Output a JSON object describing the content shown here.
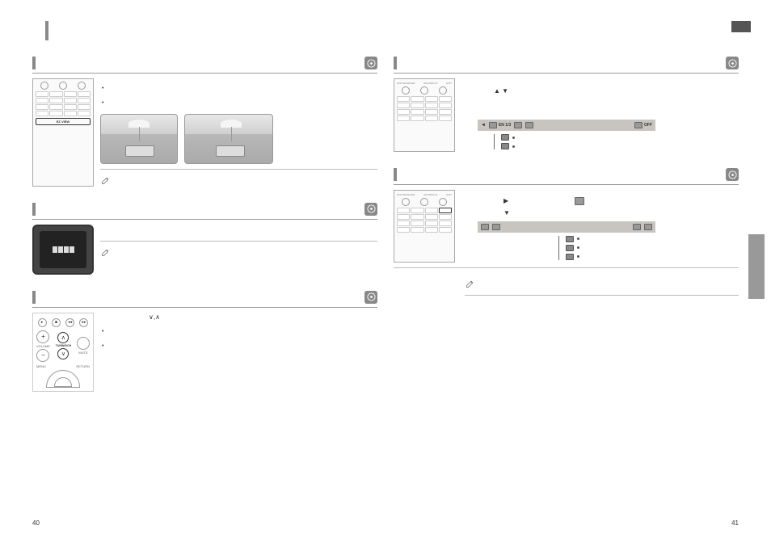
{
  "pageNumbers": {
    "left": "40",
    "right": "41"
  },
  "left": {
    "sections": [
      {
        "id": "ezview",
        "remoteHighlight": "EZ VIEW",
        "bullets": [
          "",
          ""
        ]
      },
      {
        "id": "tv-screen",
        "body": ""
      },
      {
        "id": "tuning",
        "tuningLabel": "TUNING/CH",
        "tuningUp": "∧",
        "tuningDown": "∨",
        "bullets": [
          "",
          ""
        ],
        "arrowSymbols": "∨,∧"
      }
    ]
  },
  "right": {
    "sections": [
      {
        "id": "audio-lang",
        "infoBar": {
          "leftArrow": "◄",
          "segments": [
            {
              "icon": true,
              "label": "EN 1/3"
            },
            {
              "icon": true,
              "label": ""
            },
            {
              "icon": true,
              "label": ""
            },
            {
              "label": "OFF"
            }
          ]
        },
        "arrowsText": "▲ ▼",
        "subItems": 2
      },
      {
        "id": "subtitle-lang",
        "infoBar": {
          "segments": [
            {
              "icon": true,
              "label": ""
            },
            {
              "icon": true,
              "label": ""
            },
            {
              "icon": true,
              "label": ""
            },
            {
              "icon": true,
              "label": ""
            }
          ]
        },
        "playArrow": "▶",
        "downArrow": "▼",
        "subItems": 3
      }
    ]
  },
  "remoteLabels": {
    "topRow": [
      "DVD RECEIVER",
      "AM DISPLAY",
      "EXIT"
    ]
  }
}
